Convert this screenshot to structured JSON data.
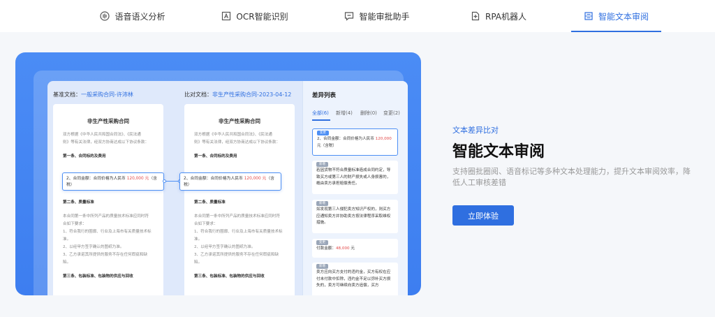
{
  "tabs": [
    {
      "label": "语音语义分析",
      "icon": "audio-wave-icon",
      "active": false
    },
    {
      "label": "OCR智能识别",
      "icon": "scan-text-icon",
      "active": false
    },
    {
      "label": "智能审批助手",
      "icon": "message-check-icon",
      "active": false
    },
    {
      "label": "RPA机器人",
      "icon": "robot-file-icon",
      "active": false
    },
    {
      "label": "智能文本审阅",
      "icon": "compare-list-icon",
      "active": true
    }
  ],
  "demo": {
    "base_doc": {
      "prefix": "基准文档：",
      "name": "一般采购合同-许沛林"
    },
    "compare_doc": {
      "prefix": "比对文档：",
      "name": "非生产性采购合同-2023-04-12"
    },
    "doc_title": "非生产性采购合同",
    "doc_lines": [
      "双方根据《中华人民共和国合同法》、《民法通",
      "则》等有关法律，经双方协商达成以下协议条款：",
      "第一条、合同标的及费用",
      "第二条、质量标准",
      "本合同第一条中所列产品的质量技术标准应同时符",
      "合如下要求：",
      "1、符合我行的圈廓、行业及上海市有关质量技术标",
      "准。",
      "2、以经甲方签字确认的图纸为准。",
      "3、乙方承诺其所提供的服务不存在任何瑕疵和缺",
      "陷。",
      "第三条、包装标准、包装物的供应与回收"
    ],
    "callout": {
      "prefix": "2、合同金额：合同价格为人民币 ",
      "amount": "120,000 元",
      "suffix": "（含税）"
    },
    "diff_list": {
      "title": "差异列表",
      "tabs": [
        {
          "label": "全部(6)",
          "active": true
        },
        {
          "label": "新增(4)",
          "active": false
        },
        {
          "label": "删除(0)",
          "active": false
        },
        {
          "label": "变更(2)",
          "active": false
        }
      ],
      "items": [
        {
          "badge": "变更",
          "text": "2、合同金额：合同价格为人民币 ",
          "highlight": "120,000",
          "suffix": "元（含税）"
        },
        {
          "badge": "新增",
          "text": "若因货物不符合质量标准造成合同约定，导致买方或第三人的财产损失或人身损害的，概由卖方承担赔偿责任。"
        },
        {
          "badge": "新增",
          "text": "如发现第三人侵犯卖方知识产权的，则买方应通知卖方并协助卖方按法律程序采取维权措施。"
        },
        {
          "badge": "变更",
          "text": "付款金额：",
          "highlight": "48,000",
          "suffix": " 元"
        },
        {
          "badge": "新增",
          "text": "卖方应向买方支付的违约金，买方有权在应付未付款中扣除，违约金不足以弥补买方损失的，卖方可继续向卖方追偿，买方"
        }
      ]
    }
  },
  "feature": {
    "kicker": "文本差异比对",
    "headline": "智能文本审阅",
    "description": "支持圈批圈阅、语音标记等多种文本处理能力，提升文本审阅效率，降低人工审核差错",
    "cta_label": "立即体验"
  },
  "colors": {
    "accent": "#2f6fe0",
    "highlight": "#e24646",
    "showcase_bg": "#3d7ef0"
  }
}
